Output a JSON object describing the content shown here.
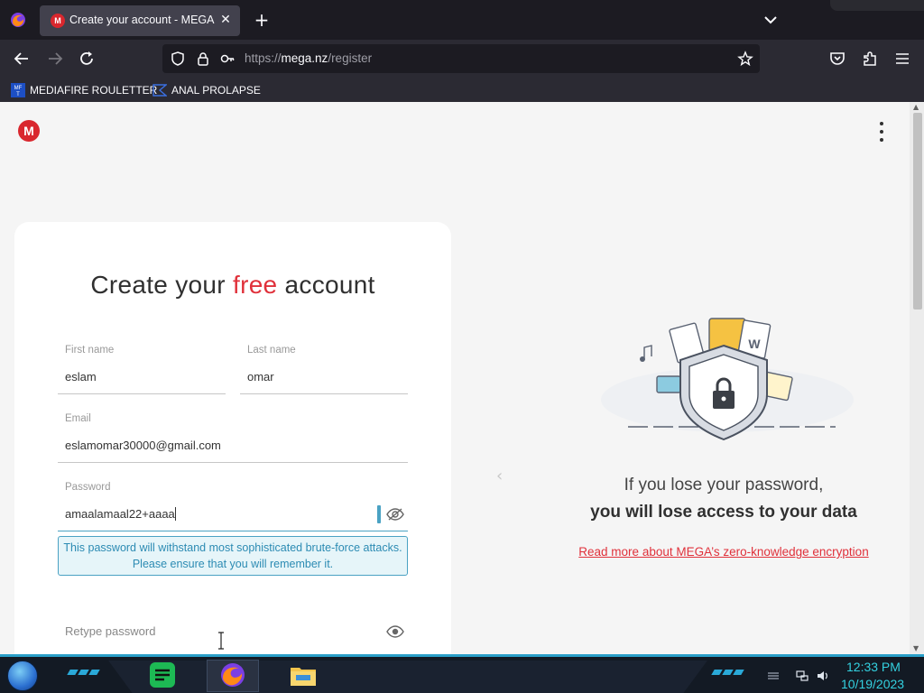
{
  "browser": {
    "tab_title": "Create your account - MEGA",
    "tab_favicon": "M",
    "url_prefix": "https://",
    "url_host": "mega.nz",
    "url_path": "/register",
    "bookmarks": [
      {
        "label": "MEDIAFIRE ROULETTER",
        "icon": "mediafire-icon"
      },
      {
        "label": "ANAL PROLAPSE",
        "icon": "bookmark-icon"
      }
    ]
  },
  "page": {
    "logo": "M",
    "title_part1": "Create your ",
    "title_free": "free",
    "title_part2": " account",
    "form": {
      "first_name_label": "First name",
      "first_name_value": "eslam",
      "last_name_label": "Last name",
      "last_name_value": "omar",
      "email_label": "Email",
      "email_value": "eslamomar30000@gmail.com",
      "password_label": "Password",
      "password_value": "amaalamaal22+aaaa",
      "password_hint": "This password will withstand most sophisticated brute-force attacks. Please ensure that you will remember it.",
      "retype_placeholder": "Retype password"
    },
    "info": {
      "line1": "If you lose your password,",
      "line2": "you will lose access to your data",
      "link": "Read more about MEGA’s zero-knowledge encryption"
    }
  },
  "taskbar": {
    "time": "12:33 PM",
    "date": "10/19/2023"
  },
  "colors": {
    "accent": "#e0313b",
    "hint": "#4aa2c3",
    "taskbar_accent": "#2a9fc8"
  }
}
